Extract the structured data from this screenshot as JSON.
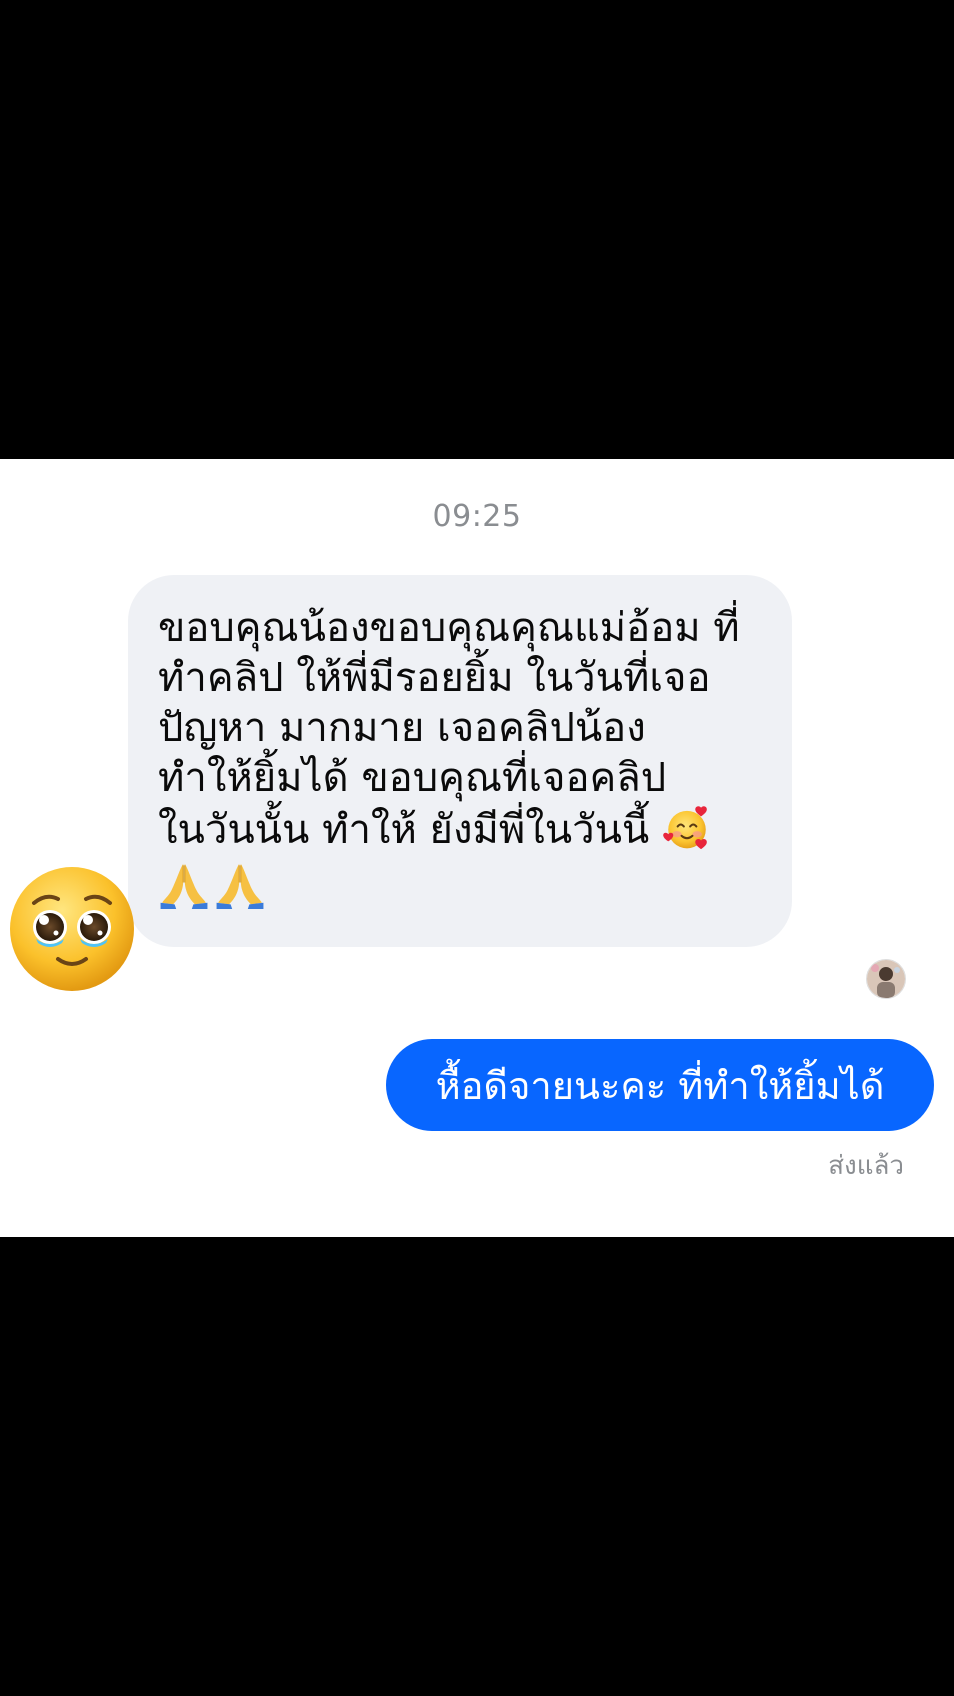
{
  "thread": {
    "timestamp": "09:25",
    "incoming": {
      "text": "ขอบคุณน้องขอบคุณคุณแม่อ้อม  ที่\nทำคลิป ให้พี่มีรอยยิ้ม ในวันที่เจอ\nปัญหา มากมาย เจอคลิปน้อง\nทำให้ยิ้มได้  ขอบคุณที่เจอคลิป\nในวันนั้น  ทำให้  ยังมีพี่ในวันนี้",
      "inline_emoji": "smiling-face-with-hearts",
      "trailing_emojis": [
        "folded-hands",
        "folded-hands"
      ]
    },
    "sticker": "pleading-face",
    "outgoing": {
      "text": "หื้อดีจายนะคะ ที่ทำให้ยิ้มได้",
      "status": "ส่งแล้ว"
    }
  },
  "colors": {
    "incoming_bubble": "#eff1f5",
    "outgoing_bubble": "#0866ff",
    "meta_text": "#8a8d91"
  }
}
